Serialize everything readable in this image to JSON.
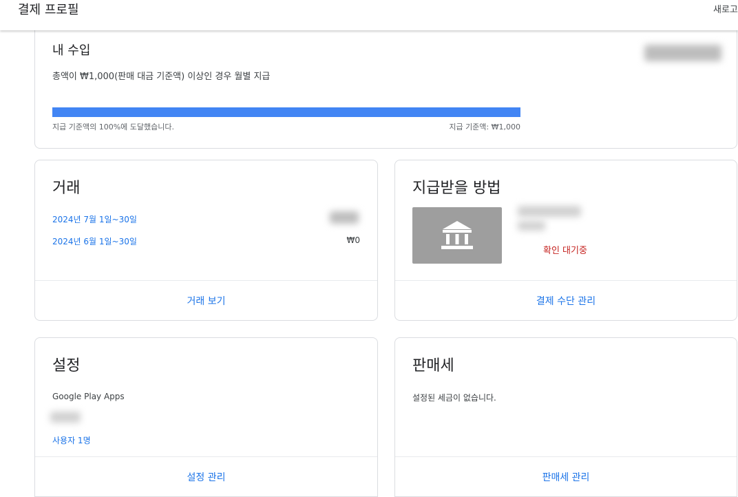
{
  "header": {
    "title": "결제 프로필",
    "new_label": "새로고침"
  },
  "income": {
    "title": "내 수입",
    "subtitle": "총액이 ₩1,000(판매 대금 기준액) 이상인 경우 월별 지급",
    "progress_percent": 100,
    "progress_label": "지급 기준액의 100%에 도달했습니다.",
    "threshold_label": "지급 기준액: ₩1,000",
    "accent_color": "#4285f4"
  },
  "transactions": {
    "title": "거래",
    "rows": [
      {
        "period": "2024년 7월 1일~30일",
        "amount": ""
      },
      {
        "period": "2024년 6월 1일~30일",
        "amount": "₩0"
      }
    ],
    "footer_label": "거래 보기"
  },
  "payment_method": {
    "title": "지급받을 방법",
    "icon": "bank-icon",
    "status": "확인 대기중",
    "status_color": "#c5221f",
    "footer_label": "결제 수단 관리"
  },
  "settings": {
    "title": "설정",
    "product": "Google Play Apps",
    "users_label": "사용자 1명",
    "footer_label": "설정 관리"
  },
  "sales_tax": {
    "title": "판매세",
    "description": "설정된 세금이 없습니다.",
    "footer_label": "판매세 관리"
  }
}
